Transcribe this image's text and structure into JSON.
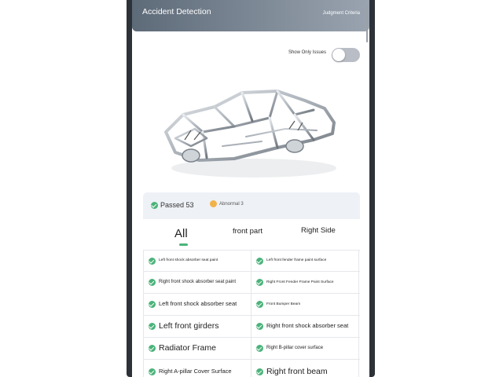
{
  "header": {
    "title": "Accident Detection",
    "link_label": "Judgment Criteria"
  },
  "filter": {
    "toggle_label": "Show Only Issues",
    "toggle_on": false
  },
  "colors": {
    "header_start": "#5d6a78",
    "header_end": "#9aa4b0",
    "pass_green": "#4bb37a",
    "warn_orange": "#f2b24a"
  },
  "summary": {
    "passed_label": "Passed 53",
    "abnormal_label": "Abnormal 3"
  },
  "tabs": [
    {
      "label": "All",
      "active": true
    },
    {
      "label": "front part",
      "active": false
    },
    {
      "label": "Right Side",
      "active": false
    }
  ],
  "items": [
    [
      "Left front shock absorber seat paint",
      "Left front fender frame paint surface"
    ],
    [
      "Right front shock absorber seat paint",
      "Right Front Fender Frame Paint Surface"
    ],
    [
      "Left front shock absorber seat",
      "Front Bumper Beam"
    ],
    [
      "Left front girders",
      "Right front shock absorber seat"
    ],
    [
      "Radiator Frame",
      "Right B-pillar cover surface"
    ],
    [
      "Right A-pillar Cover Surface",
      "Right front beam"
    ]
  ],
  "icons": {
    "pass": "check-circle-icon",
    "warning": "warning-circle-icon"
  }
}
